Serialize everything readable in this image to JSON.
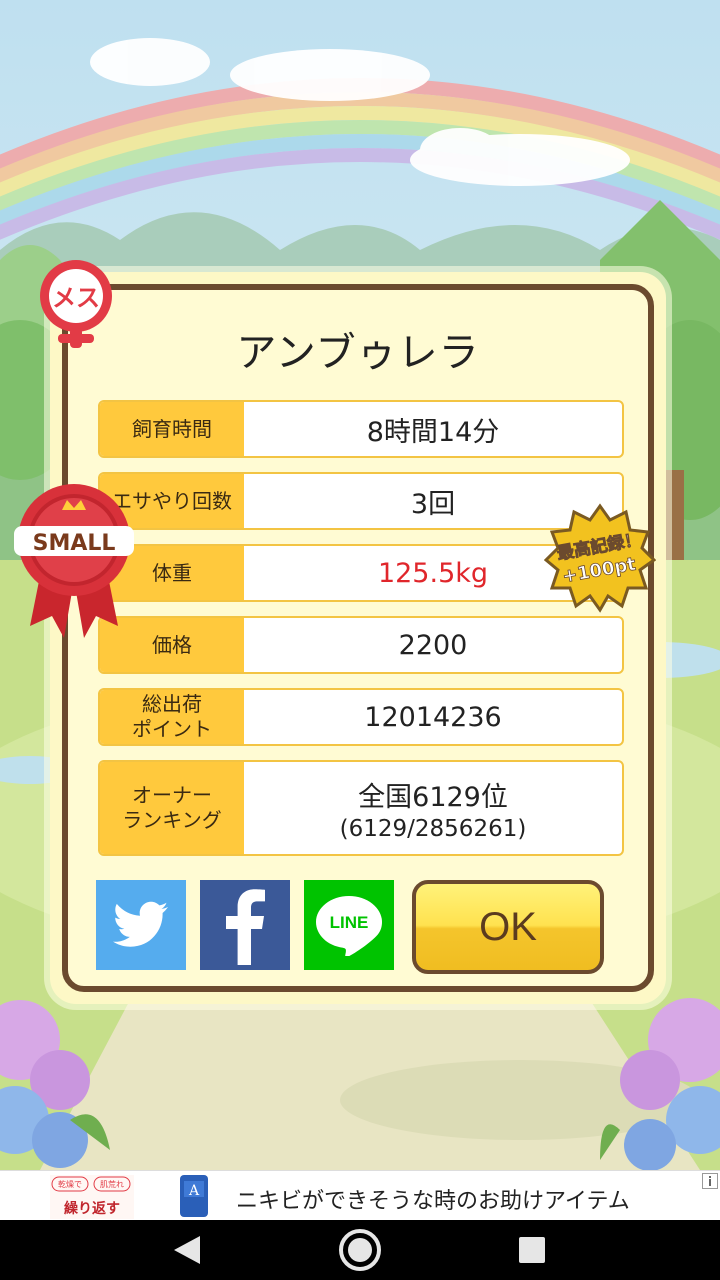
{
  "pet": {
    "name": "アンブゥレラ",
    "gender_badge": "メス",
    "size_badge": "SMALL",
    "record_badge_line1": "最高記録！",
    "record_badge_line2": "+100pt"
  },
  "stats": [
    {
      "label": "飼育時間",
      "value": "8時間14分"
    },
    {
      "label": "エサやり回数",
      "value": "3回"
    },
    {
      "label": "体重",
      "value": "125.5kg"
    },
    {
      "label": "価格",
      "value": "2200"
    },
    {
      "label_line1": "総出荷",
      "label_line2": "ポイント",
      "value": "12014236"
    },
    {
      "label_line1": "オーナー",
      "label_line2": "ランキング",
      "value": "全国6129位",
      "sub": "(6129/2856261)"
    }
  ],
  "share": {
    "twitter_icon": "twitter-bird-icon",
    "facebook_icon": "facebook-f-icon",
    "line_label": "LINE"
  },
  "ok_label": "OK",
  "ad": {
    "text": "ニキビができそうな時のお助けアイテム",
    "thumb_text1": "繰り返す",
    "thumb_tag1": "乾燥で",
    "thumb_tag2": "肌荒れ",
    "product_letter": "A"
  },
  "colors": {
    "label_bg": "#ffc93d",
    "weight_highlight": "#e0262b",
    "twitter": "#55acee",
    "facebook": "#3b5998",
    "line": "#00c300"
  }
}
